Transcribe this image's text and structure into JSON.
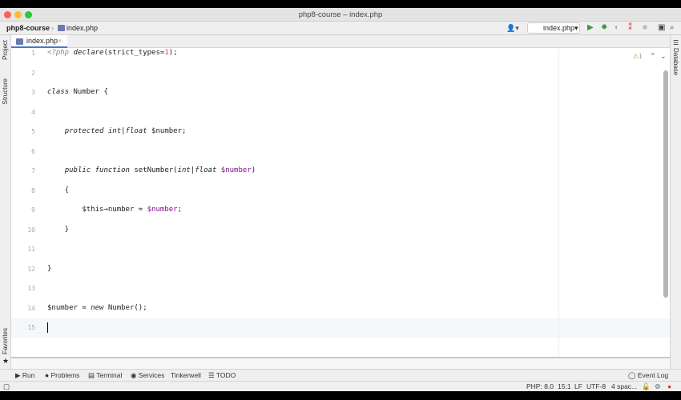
{
  "window": {
    "title": "php8-course – index.php"
  },
  "nav": {
    "project": "php8-course",
    "file": "index.php",
    "run_config": "index.php▾"
  },
  "tabs": [
    {
      "label": "index.php",
      "close": "×"
    }
  ],
  "left_tools": {
    "project": "Project",
    "structure": "Structure",
    "favorites": "Favorites"
  },
  "right_tools": {
    "database": "Database"
  },
  "inspection": {
    "warnings": "1"
  },
  "code_lines": [
    {
      "n": "1",
      "html": "<span class='gray it'>&lt;?php</span> <span class='it'>declare</span>(strict_types=<span class='num'>1</span>);"
    },
    {
      "n": "2",
      "html": ""
    },
    {
      "n": "3",
      "html": "<span class='it'>class</span> Number {"
    },
    {
      "n": "4",
      "html": ""
    },
    {
      "n": "5",
      "html": "    <span class='it'>protected int|float</span> $number;"
    },
    {
      "n": "6",
      "html": ""
    },
    {
      "n": "7",
      "html": "    <span class='it'>public function</span> setNumber(<span class='it'>int|float</span> <span class='var'>$number</span>)"
    },
    {
      "n": "8",
      "html": "    {"
    },
    {
      "n": "9",
      "html": "        $this→number = <span class='var'>$number</span>;"
    },
    {
      "n": "10",
      "html": "    }"
    },
    {
      "n": "11",
      "html": ""
    },
    {
      "n": "12",
      "html": "}"
    },
    {
      "n": "13",
      "html": ""
    },
    {
      "n": "14",
      "html": "$number = <span class='it'>new</span> Number();"
    },
    {
      "n": "15",
      "html": ""
    }
  ],
  "tool_windows": [
    "Run",
    "Problems",
    "Terminal",
    "Services",
    "Tinkerwell",
    "TODO"
  ],
  "event_log": "Event Log",
  "status": {
    "php": "PHP: 8.0",
    "position": "15:1",
    "line_sep": "LF",
    "encoding": "UTF-8",
    "indent": "4 spac..."
  }
}
